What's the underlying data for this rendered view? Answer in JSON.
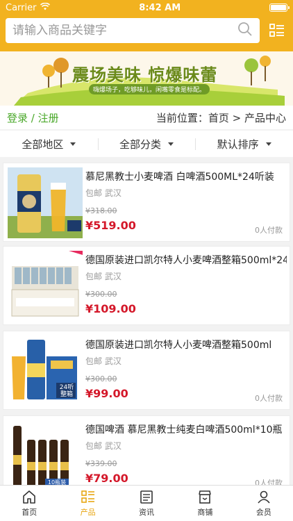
{
  "status": {
    "carrier": "Carrier",
    "time": "8:42 AM"
  },
  "search": {
    "placeholder": "请输入商品关键字"
  },
  "banner": {
    "headline": "震场美味 惊爆味蕾",
    "tagline": "嗨爆场子，吃够味儿，闲嘴零食是标配。"
  },
  "breadcrumb": {
    "login": "登录 / 注册",
    "location": "当前位置：首页 > 产品中心"
  },
  "filters": [
    {
      "label": "全部地区"
    },
    {
      "label": "全部分类"
    },
    {
      "label": "默认排序"
    }
  ],
  "products": [
    {
      "title": "慕尼黑教士小麦啤酒 白啤酒500ML*24听装",
      "ship": "包邮 武汉",
      "original": "¥318.00",
      "price": "¥519.00",
      "paid": "0人付款"
    },
    {
      "title": "德国原装进口凯尔特人小麦啤酒整箱500ml*24",
      "ship": "包邮 武汉",
      "original": "¥300.00",
      "price": "¥109.00",
      "paid": ""
    },
    {
      "title": "德国原装进口凯尔特人小麦啤酒整箱500ml",
      "ship": "包邮 武汉",
      "original": "¥300.00",
      "price": "¥99.00",
      "paid": "0人付款"
    },
    {
      "title": "德国啤酒 慕尼黑教士纯麦白啤酒500ml*10瓶",
      "ship": "包邮 武汉",
      "original": "¥339.00",
      "price": "¥79.00",
      "paid": "0人付款"
    }
  ],
  "thumb_labels": {
    "box3": "24听\n整箱",
    "box4": "10瓶装"
  },
  "tabs": [
    {
      "label": "首页",
      "icon": "home-icon"
    },
    {
      "label": "产品",
      "icon": "grid-list-icon"
    },
    {
      "label": "资讯",
      "icon": "news-icon"
    },
    {
      "label": "商铺",
      "icon": "shop-icon"
    },
    {
      "label": "会员",
      "icon": "user-icon"
    }
  ],
  "colors": {
    "header": "#f2b21f",
    "accent": "#e8a612",
    "price": "#d4182a",
    "login": "#4aa82a"
  }
}
